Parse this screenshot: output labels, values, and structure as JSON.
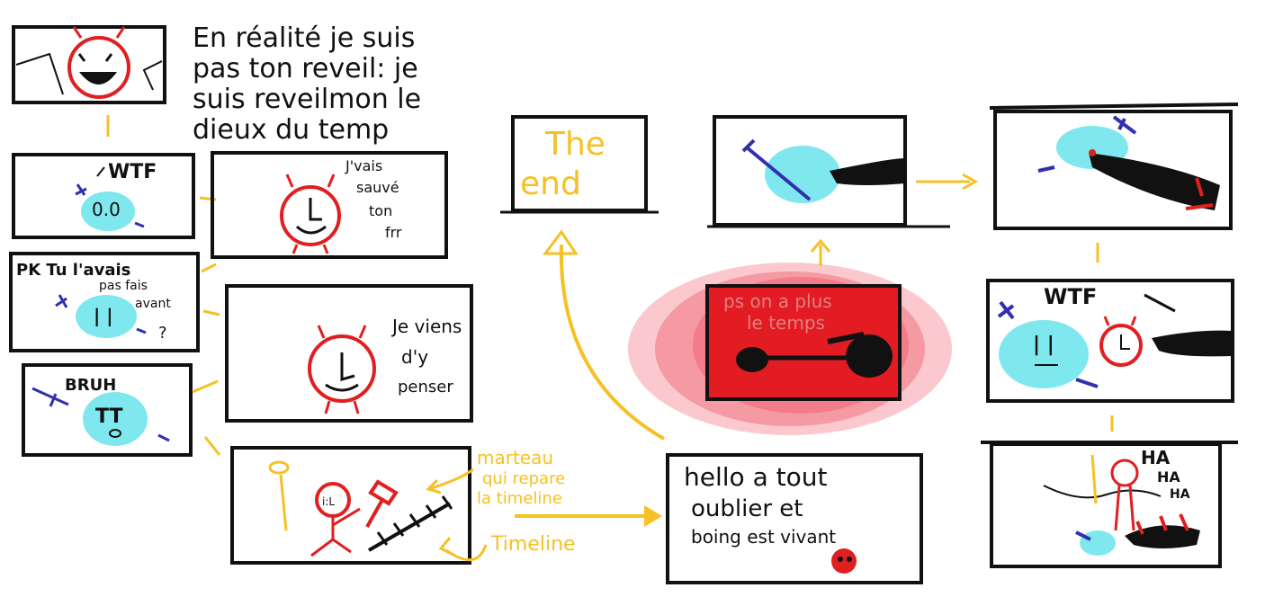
{
  "colors": {
    "ink": "#111111",
    "arrow": "#f5c125",
    "clock": "#e02020",
    "blob": "#7ee8ee",
    "accent": "#3030b0",
    "glow": "#f06070",
    "panel_red": "#e21c22",
    "background": "#ffffff"
  },
  "icons": [
    "clock-character-icon",
    "blob-character-icon",
    "hammer-icon",
    "timeline-icon",
    "big-arrow-icon"
  ],
  "texts": {
    "intro_line1": "En réalité je suis",
    "intro_line2": "pas ton reveil: je",
    "intro_line3": "suis reveilmon le",
    "intro_line4": "dieux du temp",
    "wtf_left": "WTF",
    "blob_eyes": "0.0",
    "saved_line1": "J'vais",
    "saved_line2": "sauvé",
    "saved_line3": "ton",
    "saved_line4": "frr",
    "pk_line1": "PK Tu l'avais",
    "pk_line2": "pas fais",
    "pk_line3": "avant",
    "question": "?",
    "vienn_line1": "Je viens",
    "vienn_line2": "d'y",
    "vienn_line3": "penser",
    "bruh": "BRUH",
    "tt": "TT",
    "hammer_note_line1": "marteau",
    "hammer_note_line2": "qui repare",
    "hammer_note_line3": "la timeline",
    "timeline_label": "Timeline",
    "the_end_line1": "The",
    "the_end_line2": "end",
    "hello_line1": "hello a tout",
    "hello_line2": "oublier et",
    "hello_line3": "boing est vivant",
    "red_line1": "ps on a plus",
    "red_line2": "le temps",
    "wtf_right": "WTF",
    "ha1": "HA",
    "ha2": "HA",
    "ha3": "HA"
  }
}
